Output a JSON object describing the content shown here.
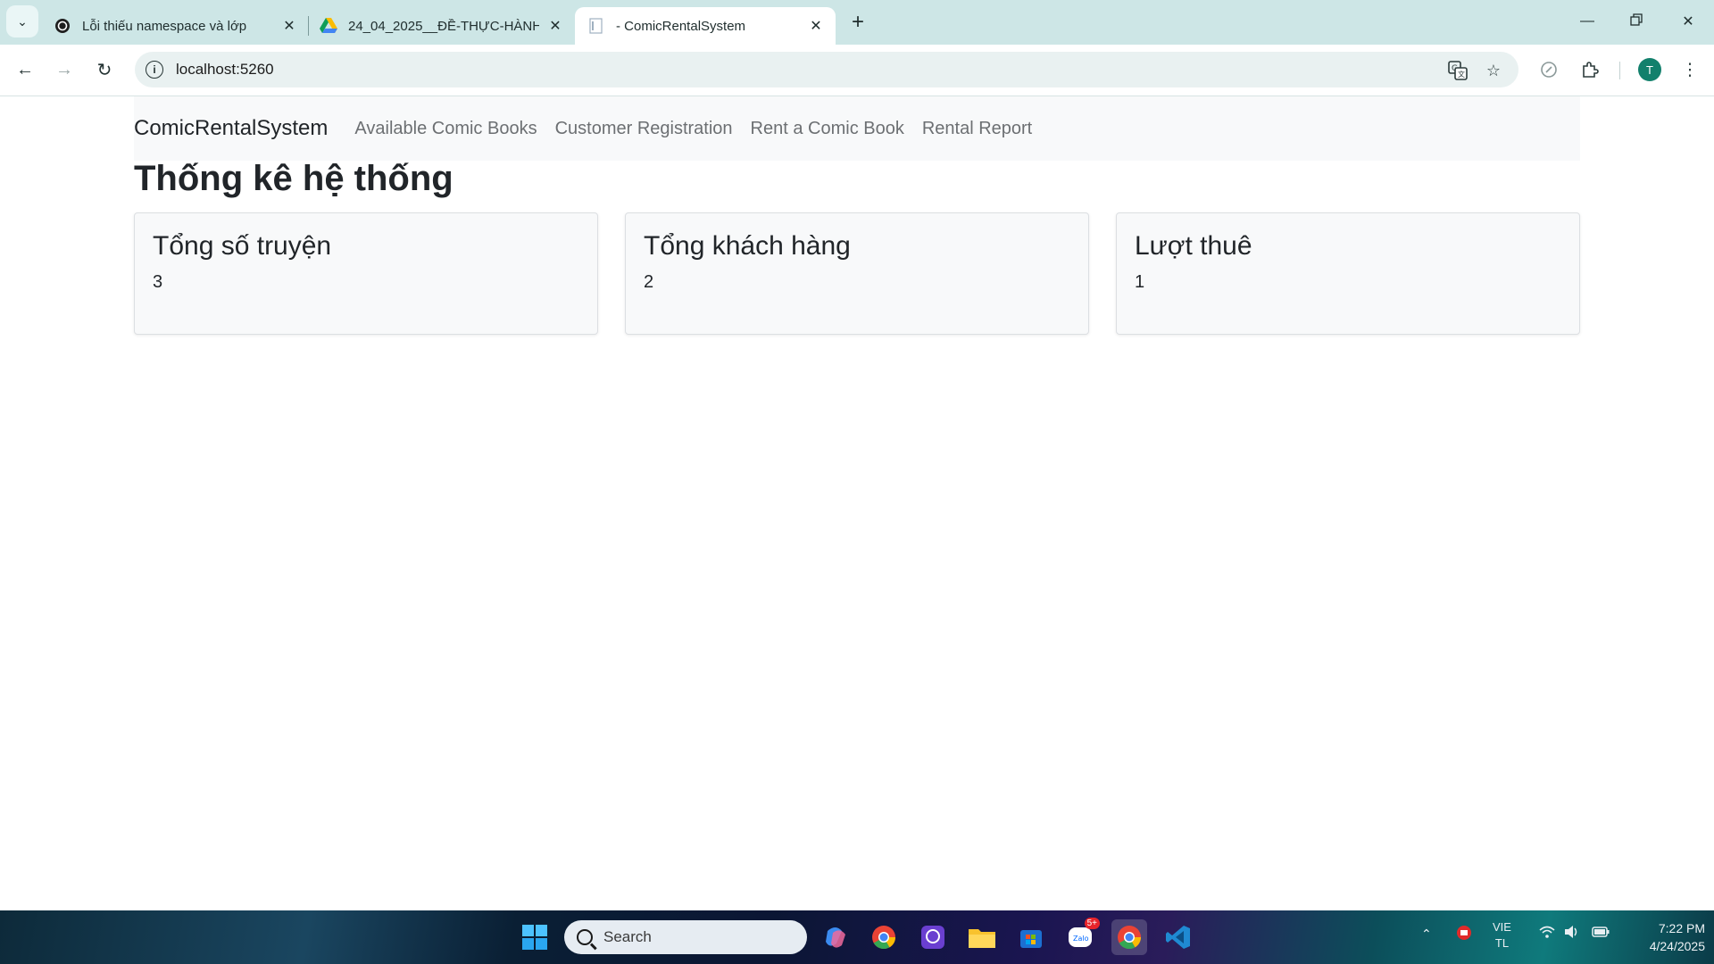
{
  "browser": {
    "tabs": [
      {
        "title": "Lỗi thiếu namespace và lớp",
        "icon": "openai-icon",
        "active": false
      },
      {
        "title": "24_04_2025__ĐỀ-THỰC-HÀNH",
        "icon": "google-drive-icon",
        "active": false
      },
      {
        "title": "- ComicRentalSystem",
        "icon": "document-icon",
        "active": true
      }
    ],
    "url": "localhost:5260",
    "profile_initial": "T"
  },
  "navbar": {
    "brand": "ComicRentalSystem",
    "links": [
      "Available Comic Books",
      "Customer Registration",
      "Rent a Comic Book",
      "Rental Report"
    ]
  },
  "page": {
    "title": "Thống kê hệ thống",
    "stats": [
      {
        "label": "Tổng số truyện",
        "value": "3"
      },
      {
        "label": "Tổng khách hàng",
        "value": "2"
      },
      {
        "label": "Lượt thuê",
        "value": "1"
      }
    ]
  },
  "taskbar": {
    "search_placeholder": "Search",
    "zalo_badge": "5+",
    "language": "VIE",
    "language_sub": "TL",
    "time": "7:22 PM",
    "date": "4/24/2025"
  }
}
